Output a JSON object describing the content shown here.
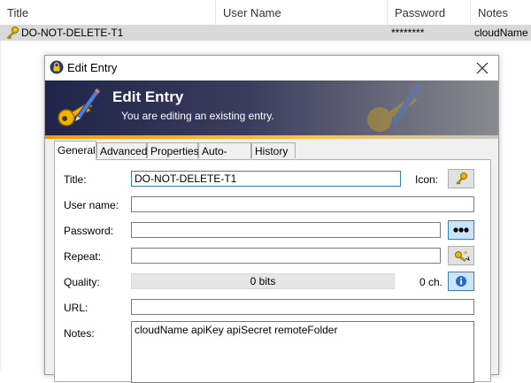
{
  "list": {
    "columns": [
      "Title",
      "User Name",
      "Password",
      "Notes"
    ],
    "row": {
      "title": "DO-NOT-DELETE-T1",
      "user_name": "",
      "password": "********",
      "notes": "cloudName"
    }
  },
  "dialog": {
    "window_title": "Edit Entry",
    "banner_title": "Edit Entry",
    "banner_subtitle": "You are editing an existing entry.",
    "tabs": [
      "General",
      "Advanced",
      "Properties",
      "Auto-Type",
      "History"
    ],
    "active_tab": "General",
    "fields": {
      "title_label": "Title:",
      "title_value": "DO-NOT-DELETE-T1",
      "icon_label": "Icon:",
      "username_label": "User name:",
      "username_value": "",
      "password_label": "Password:",
      "password_value": "",
      "repeat_label": "Repeat:",
      "repeat_value": "",
      "quality_label": "Quality:",
      "quality_value": "0 bits",
      "quality_chars": "0 ch.",
      "url_label": "URL:",
      "url_value": "",
      "notes_label": "Notes:",
      "notes_value": "cloudName apiKey apiSecret remoteFolder"
    }
  },
  "colors": {
    "selection_row": "#d9d9d9",
    "banner_dark": "#1f2448",
    "banner_accent": "#f79a00",
    "focus_border": "#3c7fb1"
  },
  "icons": [
    "key-icon",
    "lock-icon",
    "close-icon",
    "pencil-key-icon",
    "dots-icon",
    "password-generator-icon",
    "info-icon"
  ]
}
